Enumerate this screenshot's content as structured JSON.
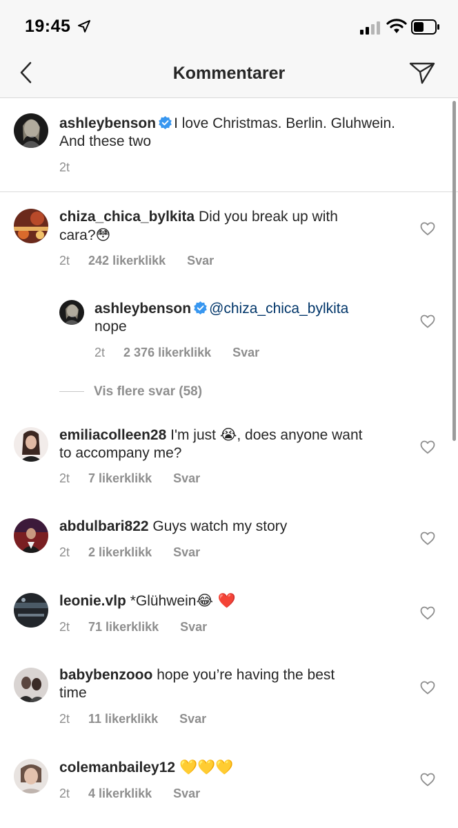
{
  "status_bar": {
    "time": "19:45"
  },
  "header": {
    "title": "Kommentarer"
  },
  "caption": {
    "username": "ashleybenson",
    "text_line1": "I love Christmas. Berlin. Gluhwein.",
    "text_line2": "And these two",
    "time": "2t"
  },
  "comments": [
    {
      "username": "chiza_chica_bylkita",
      "text_line1": "Did you break up with",
      "text_line2": "cara?",
      "emoji": "😳",
      "time": "2t",
      "likes": "242 likerklikk",
      "reply": "Svar"
    },
    {
      "username": "emiliacolleen28",
      "text_line1_a": "I'm just",
      "emoji": "😭",
      "text_line1_b": ", does anyone want",
      "text_line2": "to accompany me?",
      "time": "2t",
      "likes": "7 likerklikk",
      "reply": "Svar"
    },
    {
      "username": "abdulbari822",
      "text_line1": "Guys watch my story",
      "time": "2t",
      "likes": "2 likerklikk",
      "reply": "Svar"
    },
    {
      "username": "leonie.vlp",
      "text_line1": "*Glühwein",
      "emoji": "😂 ❤️",
      "time": "2t",
      "likes": "71 likerklikk",
      "reply": "Svar"
    },
    {
      "username": "babybenzooo",
      "text_line1": "hope you’re having the best",
      "text_line2": "time",
      "time": "2t",
      "likes": "11 likerklikk",
      "reply": "Svar"
    },
    {
      "username": "colemanbailey12",
      "emoji": "💛💛💛",
      "time": "2t",
      "likes": "4 likerklikk",
      "reply": "Svar"
    }
  ],
  "reply_item": {
    "username": "ashleybenson",
    "mention": "@chiza_chica_bylkita",
    "text_line2": "nope",
    "time": "2t",
    "likes": "2 376 likerklikk",
    "reply": "Svar"
  },
  "more_replies": "Vis flere svar (58)",
  "colors": {
    "mention": "#003569",
    "verified": "#3897f0",
    "meta": "#8e8e8e"
  }
}
